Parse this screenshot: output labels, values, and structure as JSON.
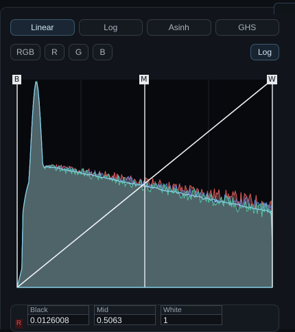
{
  "stretch_modes": [
    {
      "label": "Linear",
      "active": true
    },
    {
      "label": "Log",
      "active": false
    },
    {
      "label": "Asinh",
      "active": false
    },
    {
      "label": "GHS",
      "active": false
    }
  ],
  "channels": [
    {
      "label": "RGB"
    },
    {
      "label": "R"
    },
    {
      "label": "G"
    },
    {
      "label": "B"
    }
  ],
  "log_toggle": {
    "label": "Log",
    "active": true
  },
  "handles": {
    "black": "B",
    "mid": "M",
    "white": "W"
  },
  "colors": {
    "red": "#e05a5a",
    "green": "#4fc9a0",
    "blue": "#5c86d6",
    "fill": "#4e6669",
    "axis": "#8ad2ee"
  },
  "values": {
    "channel_chip": "R",
    "black_label": "Black",
    "black_value": "0.0126008",
    "mid_label": "Mid",
    "mid_value": "0.5063",
    "white_label": "White",
    "white_value": "1"
  }
}
